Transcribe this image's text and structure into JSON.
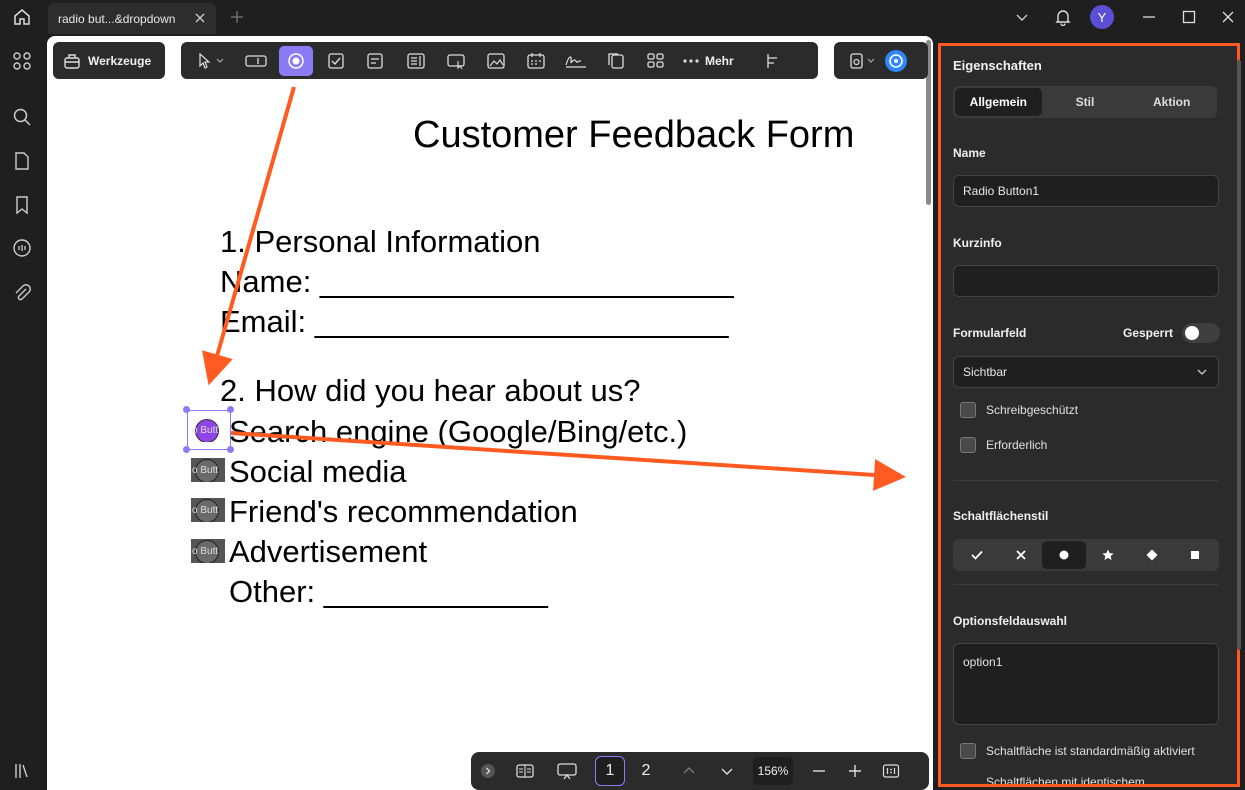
{
  "titlebar": {
    "tab_title": "radio but...&dropdown",
    "avatar_letter": "Y"
  },
  "toolbar": {
    "tools_label": "Werkzeuge",
    "more_label": "Mehr"
  },
  "document": {
    "title": "Customer Feedback Form",
    "section1": "1. Personal Information",
    "name_line": "Name: ________________________",
    "email_line": "Email: ________________________",
    "section2": "2. How did you hear about us?",
    "options": [
      "Search engine (Google/Bing/etc.)",
      "Social media",
      "Friend's recommendation",
      "Advertisement"
    ],
    "other_line": "Other: _____________",
    "radio_label": "o Butt"
  },
  "bottombar": {
    "page1": "1",
    "page2": "2",
    "zoom": "156%"
  },
  "panel": {
    "title": "Eigenschaften",
    "tabs": [
      "Allgemein",
      "Stil",
      "Aktion"
    ],
    "name_label": "Name",
    "name_value": "Radio Button1",
    "tooltip_label": "Kurzinfo",
    "tooltip_value": "",
    "formfield_label": "Formularfeld",
    "locked_label": "Gesperrt",
    "visibility_value": "Sichtbar",
    "readonly_label": "Schreibgeschützt",
    "required_label": "Erforderlich",
    "buttonstyle_label": "Schaltflächenstil",
    "option_label": "Optionsfeldauswahl",
    "option_value": "option1",
    "default_checked_label": "Schaltfläche ist standardmäßig aktiviert",
    "same_name_label": "Schaltflächen mit identischem"
  },
  "colors": {
    "accent": "#8b7cf6",
    "highlight": "#ff5a1f",
    "selected_radio": "#8e44e6"
  }
}
